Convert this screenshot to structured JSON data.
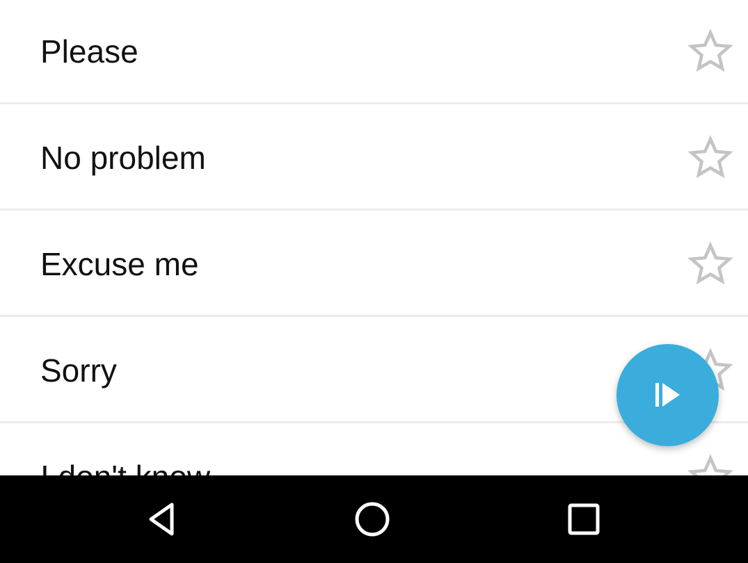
{
  "phrases": {
    "items": [
      {
        "label": "Please",
        "starred": false
      },
      {
        "label": "No problem",
        "starred": false
      },
      {
        "label": "Excuse me",
        "starred": false
      },
      {
        "label": "Sorry",
        "starred": false
      },
      {
        "label": "I don't know",
        "starred": false
      }
    ]
  },
  "icons": {
    "favorite": "star-outline-icon",
    "fab": "play-all-icon",
    "nav_back": "back-icon",
    "nav_home": "home-icon",
    "nav_recents": "recents-icon"
  },
  "colors": {
    "accent": "#3aaddc",
    "star_outline": "#c4c4c4",
    "divider": "#ececec",
    "text": "#111111",
    "navbar": "#000000"
  }
}
